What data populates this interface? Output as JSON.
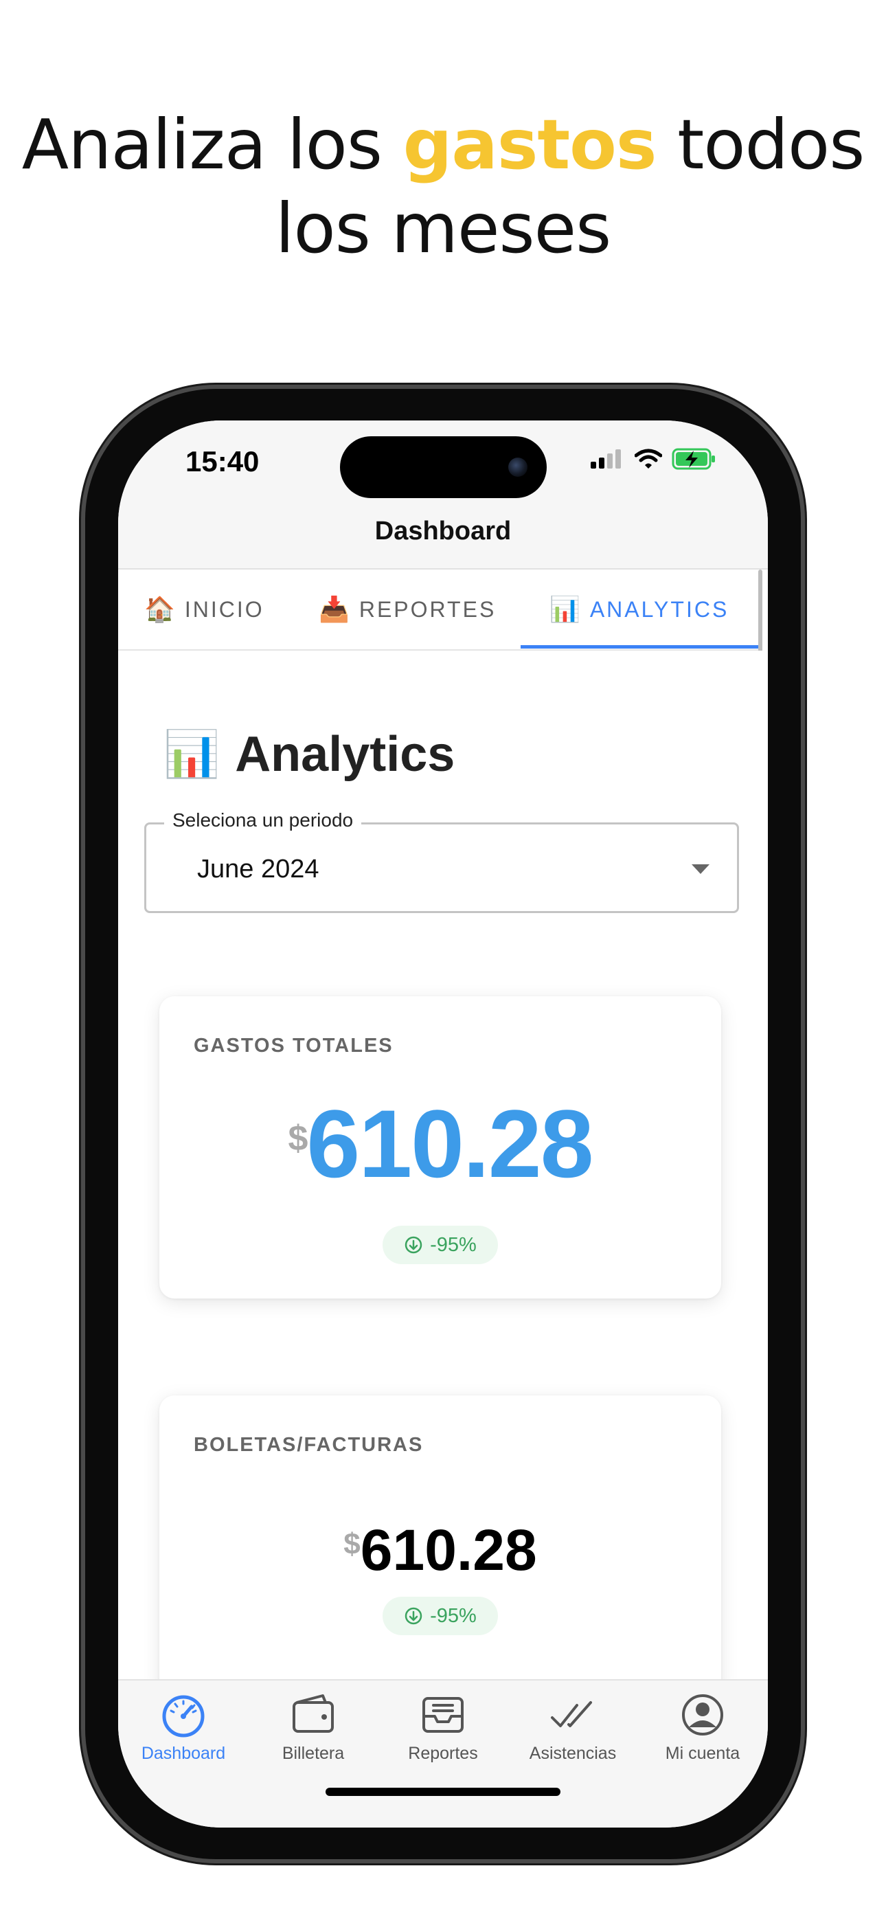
{
  "headline": {
    "line1_a": "Analiza los ",
    "highlight": "gastos",
    "line1_b": " todos",
    "line2": "los meses"
  },
  "status_bar": {
    "time": "15:40"
  },
  "nav": {
    "title": "Dashboard"
  },
  "tabs": [
    {
      "emoji": "🏠",
      "label": "INICIO",
      "active": false
    },
    {
      "emoji": "📥",
      "label": "REPORTES",
      "active": false
    },
    {
      "emoji": "📊",
      "label": "ANALYTICS",
      "active": true
    }
  ],
  "page": {
    "emoji": "📊",
    "title": "Analytics"
  },
  "period_select": {
    "label": "Seleciona un periodo",
    "value": "June 2024"
  },
  "cards": [
    {
      "label": "GASTOS TOTALES",
      "currency": "$",
      "amount": "610.28",
      "change": "-95%"
    },
    {
      "label": "BOLETAS/FACTURAS",
      "currency": "$",
      "amount": "610.28",
      "change": "-95%"
    }
  ],
  "bottom_nav": [
    {
      "label": "Dashboard",
      "icon": "speedometer-icon",
      "active": true
    },
    {
      "label": "Billetera",
      "icon": "wallet-icon",
      "active": false
    },
    {
      "label": "Reportes",
      "icon": "inbox-tray-icon",
      "active": false
    },
    {
      "label": "Asistencias",
      "icon": "double-check-icon",
      "active": false
    },
    {
      "label": "Mi cuenta",
      "icon": "account-circle-icon",
      "active": false
    }
  ],
  "colors": {
    "accent": "#3b82f6",
    "highlight": "#f6c531",
    "amount_blue": "#3d9be9",
    "positive_green": "#3aa35e"
  }
}
